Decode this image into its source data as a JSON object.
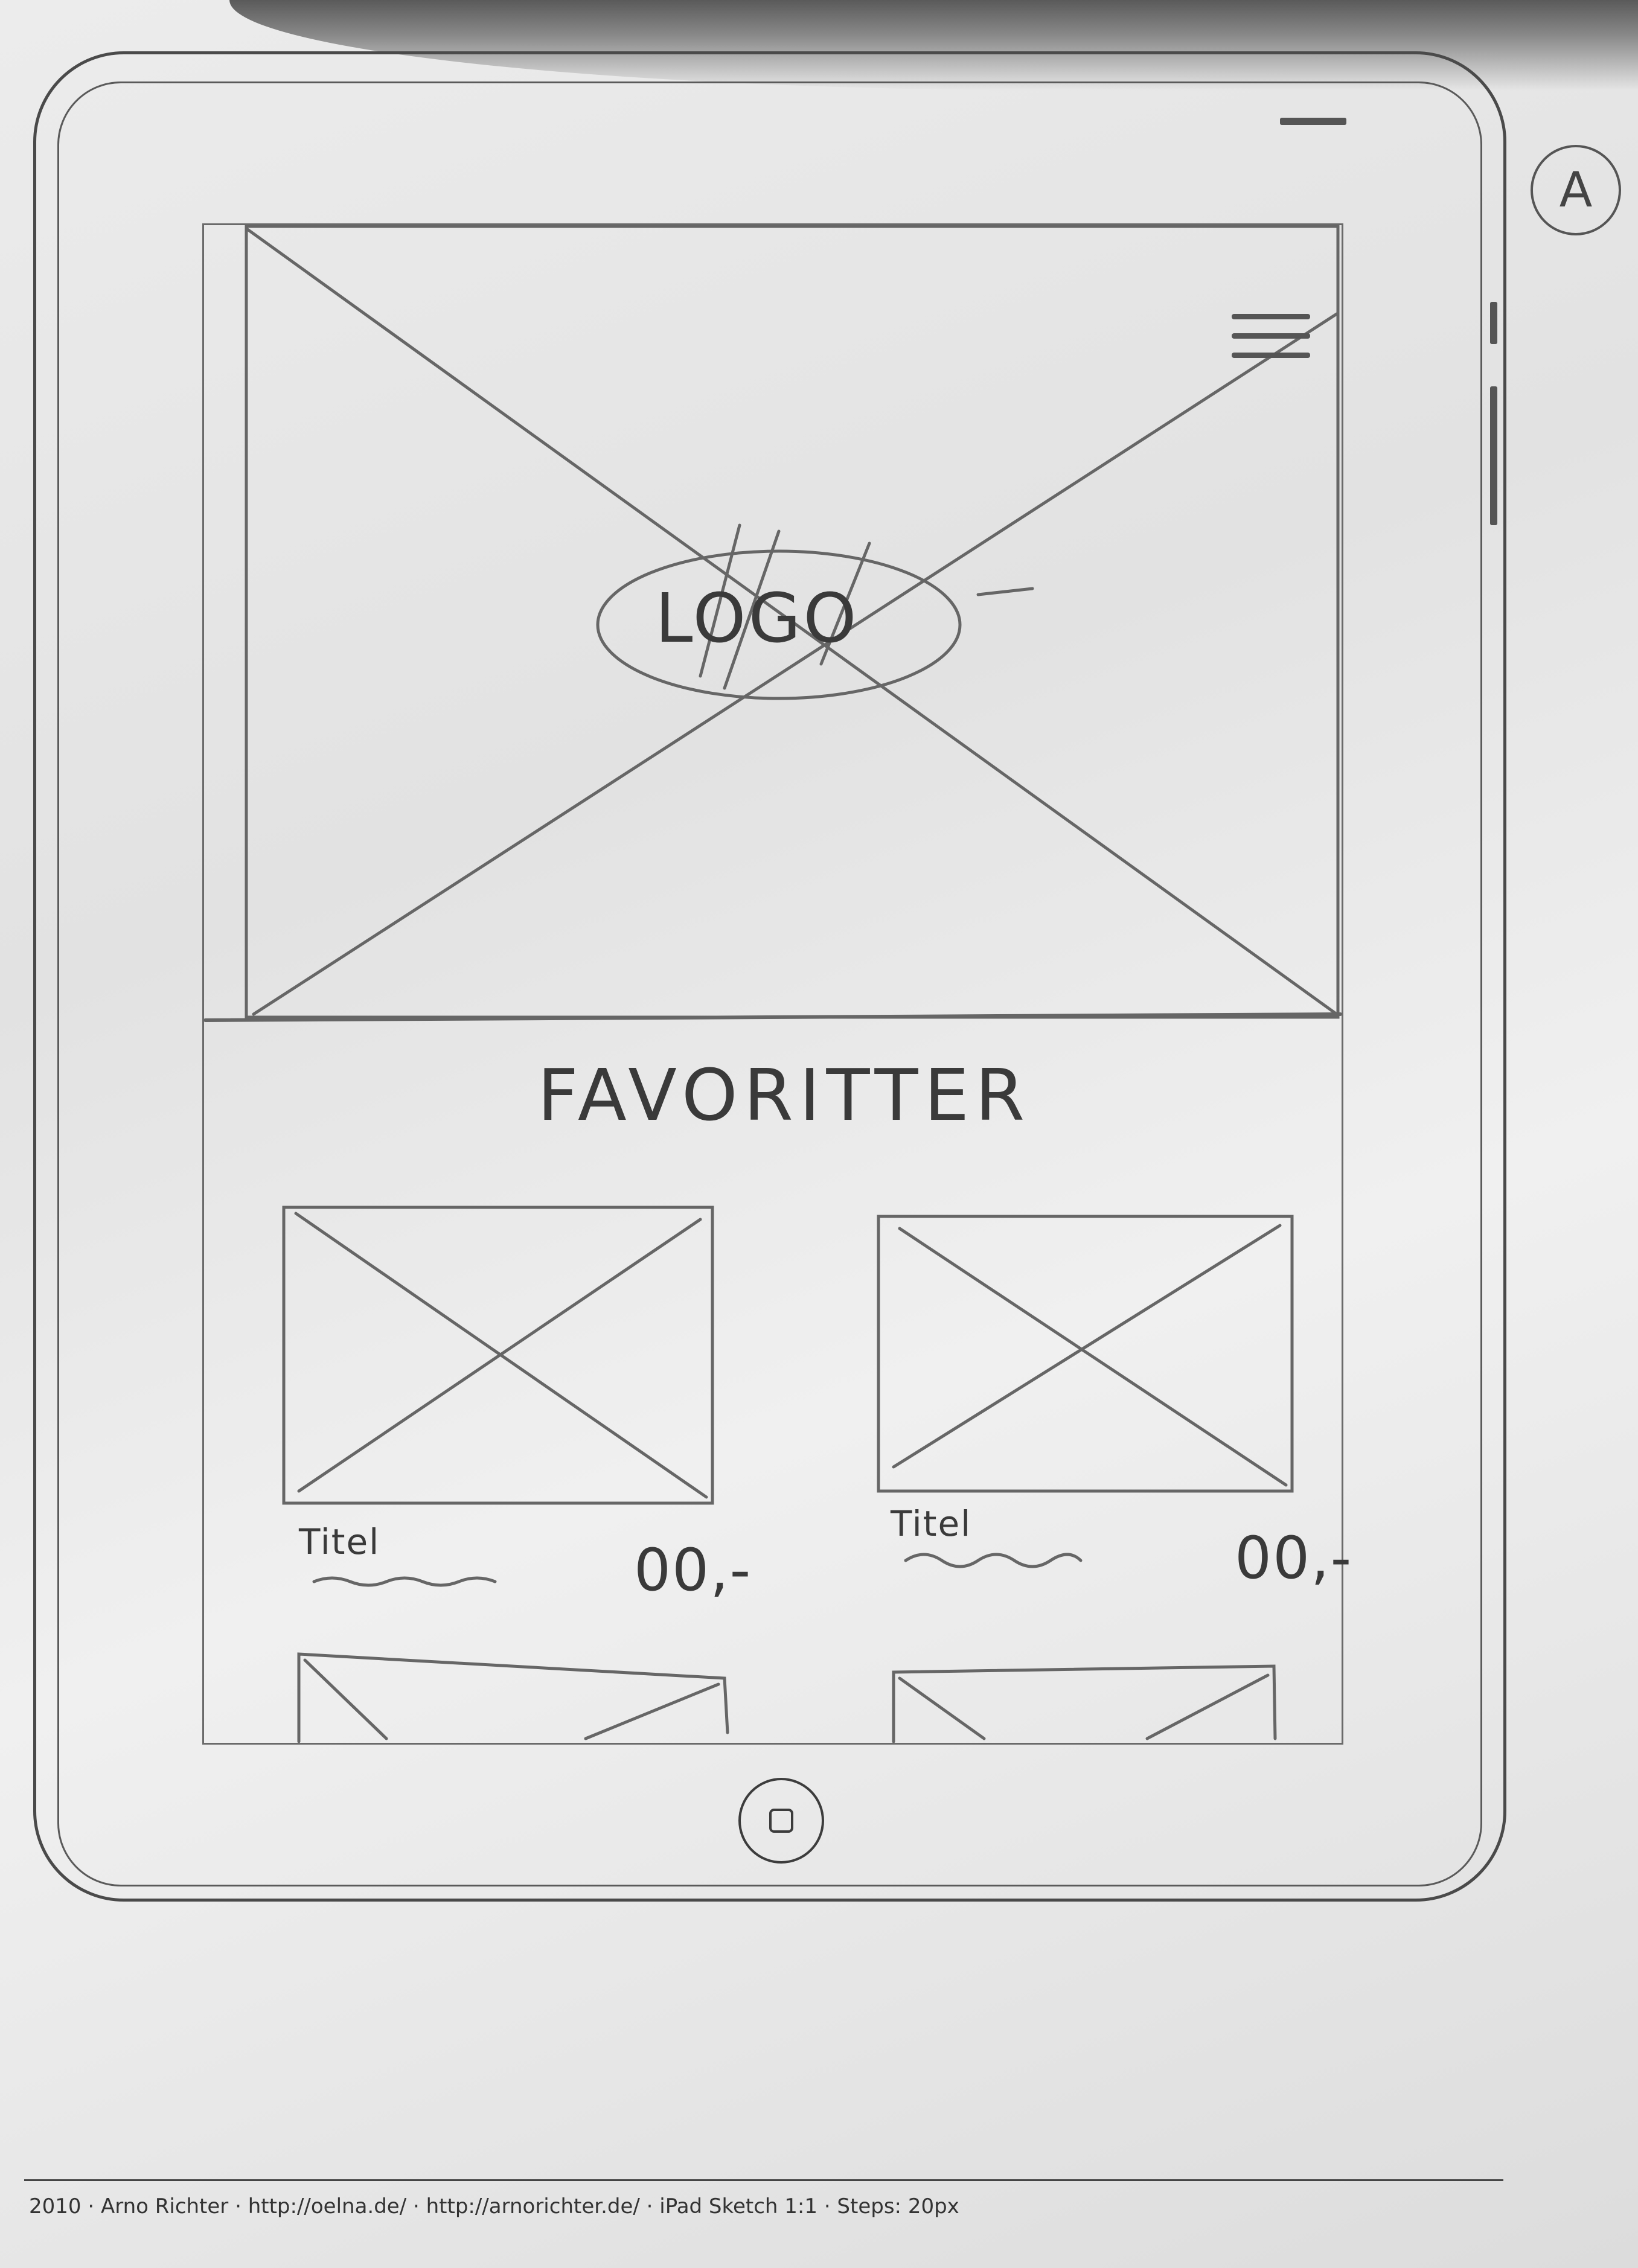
{
  "sheet": {
    "version_mark": "A"
  },
  "hero": {
    "logo_text": "LOGO"
  },
  "section": {
    "title": "FAVORITTER"
  },
  "cards": [
    {
      "title": "Titel",
      "price": "00,-"
    },
    {
      "title": "Titel",
      "price": "00,-"
    }
  ],
  "footer": {
    "text": "2010 · Arno Richter · http://oelna.de/ · http://arnorichter.de/ · iPad Sketch 1:1 · Steps: 20px"
  },
  "colors": {
    "pencil": "#5a5a5a",
    "paper": "#e6e6e6"
  }
}
